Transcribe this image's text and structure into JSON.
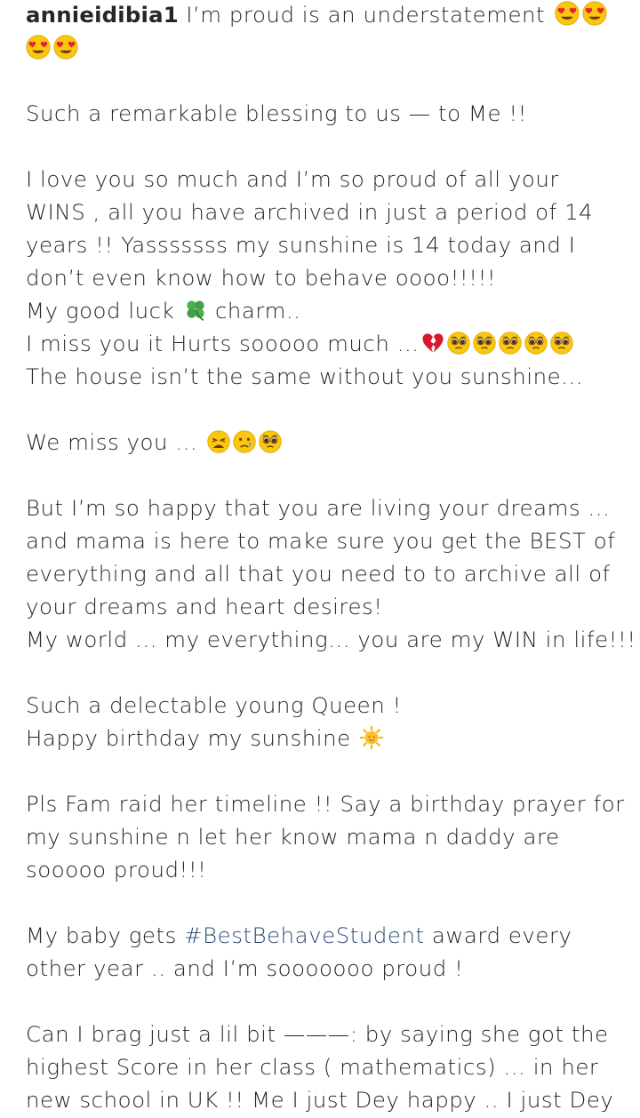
{
  "post": {
    "username": "annieidibia1",
    "caption_lines": [
      " I’m proud is an understatement",
      "Such a remarkable blessing to us — to Me !!",
      "I love you so much and I’m so proud of all your",
      "WINS , all you have archived in just a period of 14",
      "years !! Yasssssss my sunshine is 14 today and I",
      "don’t even know how to behave oooo!!!!!",
      "My good luck",
      "charm..",
      "I miss you it Hurts sooooo much ...",
      "The house isn’t the same without you sunshine...",
      "We miss you ...",
      "But I’m so happy that you are living your dreams ...",
      "and mama is here to make sure you get the BEST of",
      "everything and  all that you need to to archive all of",
      "your dreams and heart desires!",
      "My world ... my everything... you are my WIN in life!!!!",
      "Such a delectable young Queen !",
      "Happy birthday my sunshine",
      "Pls Fam raid her timeline !! Say a birthday prayer for",
      "my sunshine n let her know mama n daddy are",
      "sooooo proud!!!",
      "My baby gets",
      "#BestBehaveStudent",
      " award every",
      "other year .. and I’m sooooooo proud !",
      " Can I brag just a lil bit ———: by saying she got the",
      "highest Score in her class ( mathematics) ... in her",
      "new school in UK !! Me I just Dey happy .. I just Dey"
    ]
  },
  "emojis": {
    "heart_eyes": "heart-eyes-emoji",
    "clover": "four-leaf-clover-emoji",
    "broken_heart": "broken-heart-emoji",
    "pleading": "pleading-face-emoji",
    "weary": "weary-face-emoji",
    "crying": "crying-face-emoji",
    "sun": "sun-with-face-emoji"
  },
  "colors": {
    "text": "#262626",
    "hashtag": "#2a4a72",
    "background": "#ffffff"
  }
}
